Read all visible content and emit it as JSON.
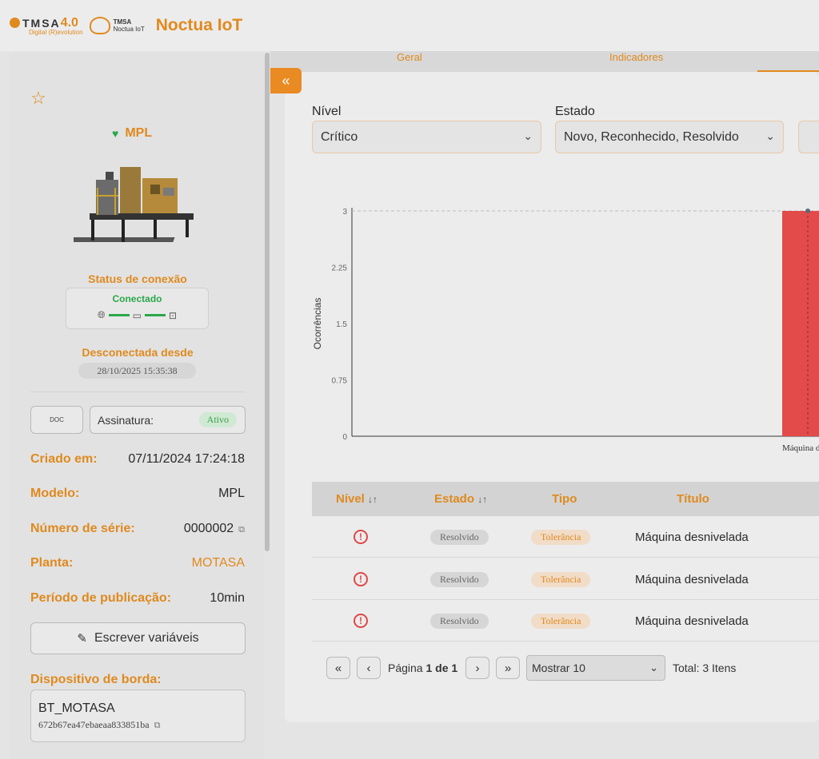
{
  "header": {
    "logo_brand": "TMSA",
    "logo_brand_version": "4.0",
    "logo_tagline": "Digital (R)evolution",
    "logo_noctua_line1": "TMSA",
    "logo_noctua_line2": "Noctua IoT",
    "app_title": "Noctua IoT"
  },
  "device": {
    "name": "MPL",
    "connection_status_label": "Status de conexão",
    "connection_status": "Conectado",
    "disconnected_since_label": "Desconectada desde",
    "disconnected_since": "28/10/2025 15:35:38",
    "doc_label": "DOC",
    "signature_label": "Assinatura:",
    "signature_status": "Ativo",
    "info": [
      {
        "key": "Criado em:",
        "value": "07/11/2024 17:24:18"
      },
      {
        "key": "Modelo:",
        "value": "MPL"
      },
      {
        "key": "Número de série:",
        "value": "0000002"
      },
      {
        "key": "Planta:",
        "value": "MOTASA"
      },
      {
        "key": "Período de publicação:",
        "value": "10min"
      }
    ],
    "write_variables_label": "Escrever variáveis",
    "edge_device_label": "Dispositivo de borda:",
    "edge_device_name": "BT_MOTASA",
    "edge_device_id": "672b67ea47ebaeaa833851ba"
  },
  "tabs": [
    {
      "label": "Geral"
    },
    {
      "label": "Indicadores"
    }
  ],
  "filters": {
    "level_label": "Nível",
    "level_value": "Crítico",
    "state_label": "Estado",
    "state_value": "Novo, Reconhecido, Resolvido"
  },
  "chart_data": {
    "type": "bar",
    "categories": [
      "Máquina desnivelada"
    ],
    "values": [
      3
    ],
    "ylabel": "Ocorrências",
    "yticks": [
      "0",
      "0.75",
      "1.5",
      "2.25",
      "3"
    ],
    "ylim": [
      0,
      3
    ],
    "bar_color": "#e34a4a",
    "grid": false
  },
  "table": {
    "headers": [
      "Nível",
      "Estado",
      "Tipo",
      "Título"
    ],
    "rows": [
      {
        "level_icon": "alert-circle-icon",
        "state": "Resolvido",
        "type": "Tolerância",
        "title": "Máquina desnivelada"
      },
      {
        "level_icon": "alert-circle-icon",
        "state": "Resolvido",
        "type": "Tolerância",
        "title": "Máquina desnivelada"
      },
      {
        "level_icon": "alert-circle-icon",
        "state": "Resolvido",
        "type": "Tolerância",
        "title": "Máquina desnivelada"
      }
    ]
  },
  "pagination": {
    "page_prefix": "Página",
    "current_page": "1",
    "page_of": "de",
    "total_pages": "1",
    "page_size": "Mostrar 10",
    "total": "Total: 3 Itens"
  },
  "colors": {
    "accent": "#e08a1e",
    "success": "#2aa84a",
    "danger": "#e04848"
  }
}
